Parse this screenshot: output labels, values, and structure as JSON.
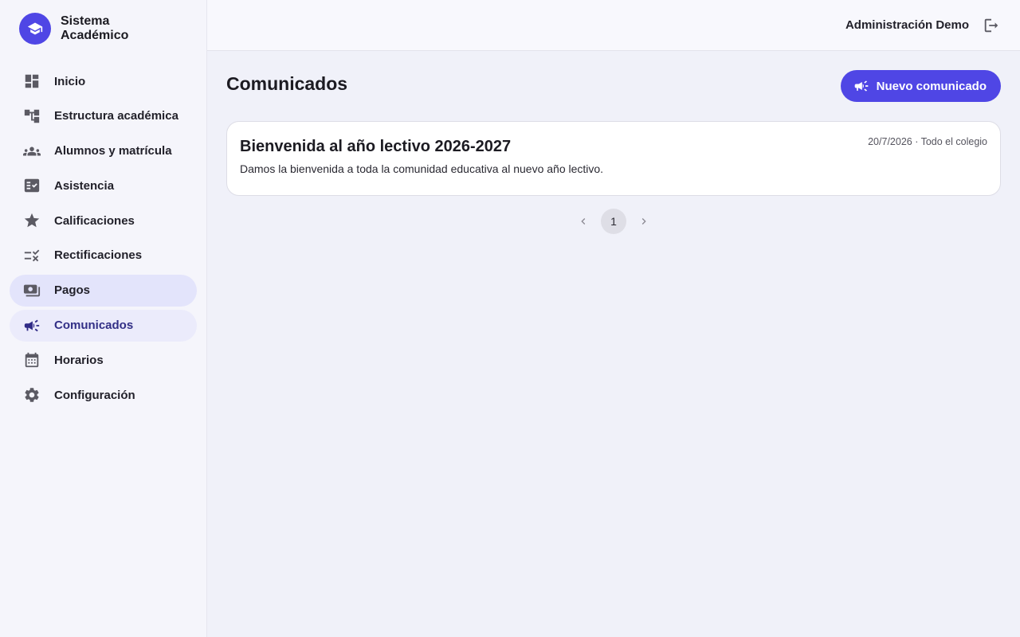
{
  "brand": {
    "name": "Sistema Académico",
    "logo_icon": "graduation-cap-icon",
    "accent": "#4f46e5"
  },
  "sidebar": {
    "items": [
      {
        "label": "Inicio",
        "icon": "dashboard-icon"
      },
      {
        "label": "Estructura académica",
        "icon": "account-tree-icon"
      },
      {
        "label": "Alumnos y matrícula",
        "icon": "groups-icon"
      },
      {
        "label": "Asistencia",
        "icon": "fact-check-icon"
      },
      {
        "label": "Calificaciones",
        "icon": "star-icon"
      },
      {
        "label": "Rectificaciones",
        "icon": "rule-icon"
      },
      {
        "label": "Pagos",
        "icon": "payments-icon"
      },
      {
        "label": "Comunicados",
        "icon": "campaign-icon"
      },
      {
        "label": "Horarios",
        "icon": "calendar-icon"
      },
      {
        "label": "Configuración",
        "icon": "gear-icon"
      }
    ],
    "active": "Comunicados",
    "hovered": "Pagos"
  },
  "header": {
    "user_name": "Administración Demo",
    "logout_icon": "logout-icon"
  },
  "main": {
    "title": "Comunicados",
    "new_button_label": "Nuevo comunicado",
    "announcements": [
      {
        "title": "Bienvenida al año lectivo 2026-2027",
        "meta": "20/7/2026 · Todo el colegio",
        "body": "Damos la bienvenida a toda la comunidad educativa al nuevo año lectivo."
      }
    ],
    "pagination": {
      "current_page": "1"
    }
  }
}
